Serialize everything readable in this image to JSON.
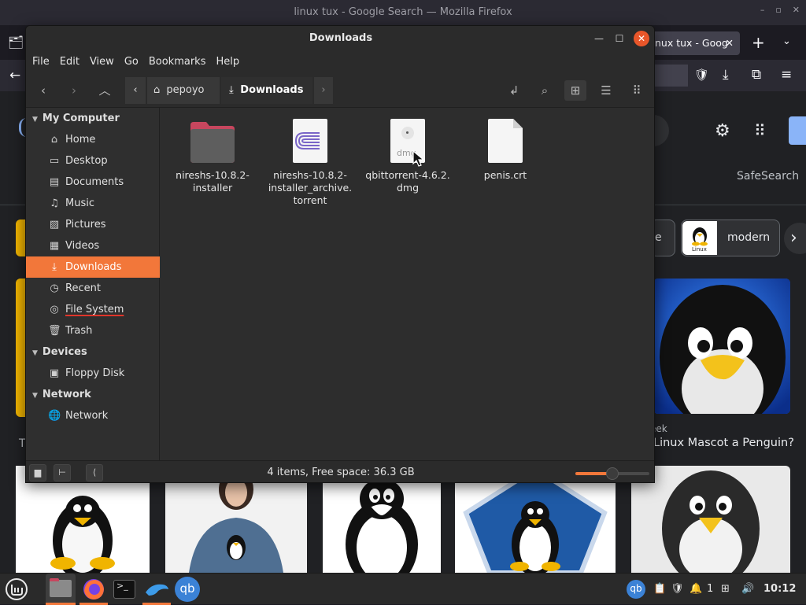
{
  "firefox": {
    "window_title": "linux tux - Google Search — Mozilla Firefox",
    "tab_title": "nux tux - Goog",
    "tab_close": "✕",
    "new_tab": "+",
    "safesearch": "SafeSearch",
    "chip_partial": "e",
    "chip_modern": "modern",
    "chip_thumb_text": "Linux",
    "result_source": "eek",
    "result_title": "Linux Mascot a Penguin?",
    "result_left_initial": "T"
  },
  "nemo": {
    "title": "Downloads",
    "menu": [
      "File",
      "Edit",
      "View",
      "Go",
      "Bookmarks",
      "Help"
    ],
    "breadcrumb": {
      "home": "pepoyo",
      "current": "Downloads"
    },
    "sidebar": {
      "my_computer": "My Computer",
      "items": [
        {
          "label": "Home",
          "icon": "home-icon"
        },
        {
          "label": "Desktop",
          "icon": "desktop-icon"
        },
        {
          "label": "Documents",
          "icon": "documents-icon"
        },
        {
          "label": "Music",
          "icon": "music-icon"
        },
        {
          "label": "Pictures",
          "icon": "pictures-icon"
        },
        {
          "label": "Videos",
          "icon": "videos-icon"
        },
        {
          "label": "Downloads",
          "icon": "downloads-icon"
        },
        {
          "label": "Recent",
          "icon": "recent-icon"
        },
        {
          "label": "File System",
          "icon": "filesystem-icon"
        },
        {
          "label": "Trash",
          "icon": "trash-icon"
        }
      ],
      "devices": "Devices",
      "device_items": [
        {
          "label": "Floppy Disk",
          "icon": "floppy-icon"
        }
      ],
      "network": "Network",
      "network_items": [
        {
          "label": "Network",
          "icon": "network-icon"
        }
      ]
    },
    "files": [
      {
        "line1": "nireshs-10.8.2-",
        "line2": "installer",
        "line3": "",
        "type": "folder"
      },
      {
        "line1": "nireshs-10.8.2-",
        "line2": "installer_archive.",
        "line3": "torrent",
        "type": "torrent"
      },
      {
        "line1": "qbittorrent-4.6.2.",
        "line2": "dmg",
        "line3": "",
        "type": "dmg",
        "thumb_label": "dmg"
      },
      {
        "line1": "penis.crt",
        "line2": "",
        "line3": "",
        "type": "document"
      }
    ],
    "status": "4 items, Free space: 36.3 GB",
    "zoom_level": 0.5
  },
  "taskbar": {
    "clock": "10:12",
    "workspace": "1",
    "qb_label": "qb"
  },
  "colors": {
    "accent": "#f2773a",
    "close": "#e8562a",
    "window_bg": "#2d2d2d"
  }
}
